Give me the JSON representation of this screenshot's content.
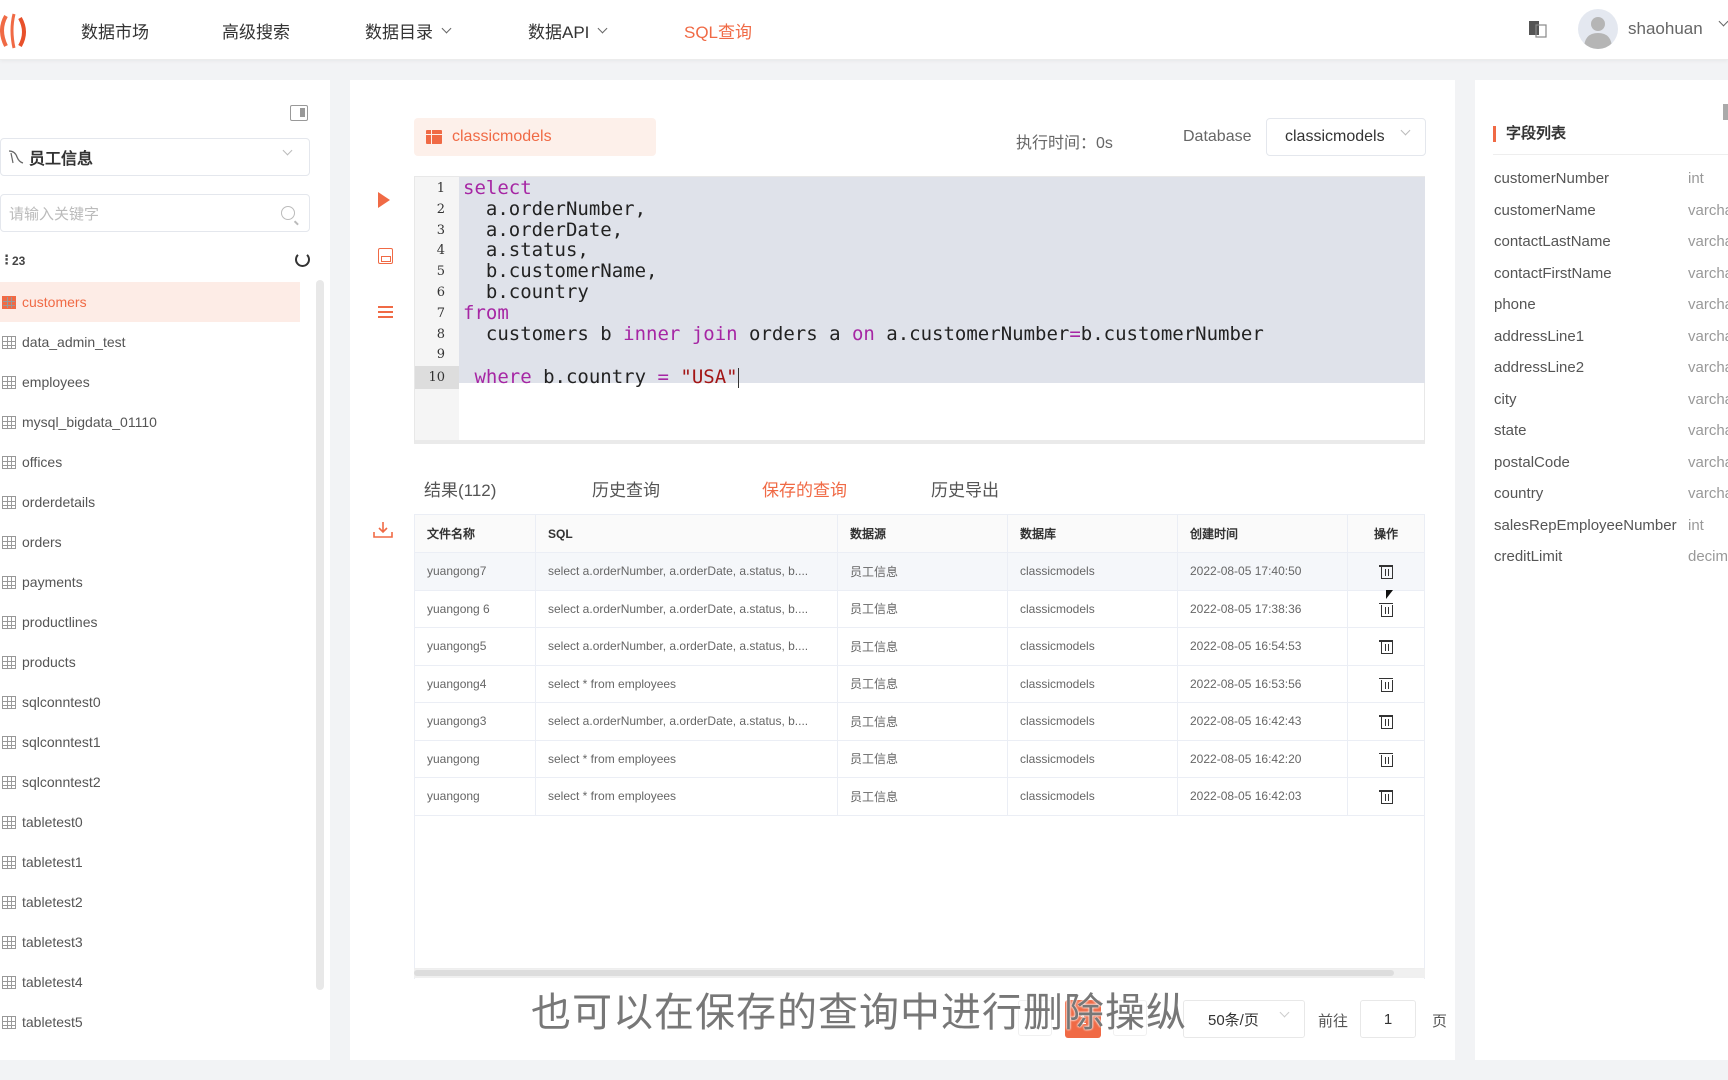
{
  "topbar": {
    "logo": "brand-logo",
    "nav": [
      {
        "label": "数据市场",
        "has_dropdown": false
      },
      {
        "label": "高级搜索",
        "has_dropdown": false
      },
      {
        "label": "数据目录",
        "has_dropdown": true
      },
      {
        "label": "数据API",
        "has_dropdown": true
      },
      {
        "label": "SQL查询",
        "has_dropdown": false,
        "active": true
      }
    ],
    "username": "shaohuan"
  },
  "left_panel": {
    "datasource": "员工信息",
    "search_placeholder": "请输入关键字",
    "table_count": "23",
    "tables": [
      {
        "name": "customers",
        "active": true
      },
      {
        "name": "data_admin_test"
      },
      {
        "name": "employees"
      },
      {
        "name": "mysql_bigdata_01110"
      },
      {
        "name": "offices"
      },
      {
        "name": "orderdetails"
      },
      {
        "name": "orders"
      },
      {
        "name": "payments"
      },
      {
        "name": "productlines"
      },
      {
        "name": "products"
      },
      {
        "name": "sqlconntest0"
      },
      {
        "name": "sqlconntest1"
      },
      {
        "name": "sqlconntest2"
      },
      {
        "name": "tabletest0"
      },
      {
        "name": "tabletest1"
      },
      {
        "name": "tabletest2"
      },
      {
        "name": "tabletest3"
      },
      {
        "name": "tabletest4"
      },
      {
        "name": "tabletest5"
      }
    ]
  },
  "editor": {
    "db_tag": "classicmodels",
    "exec_time": "执行时间：0s",
    "database_label": "Database",
    "database_value": "classicmodels",
    "lines": [
      {
        "n": "1",
        "code": "select"
      },
      {
        "n": "2",
        "code": "  a.orderNumber,"
      },
      {
        "n": "3",
        "code": "  a.orderDate,"
      },
      {
        "n": "4",
        "code": "  a.status,"
      },
      {
        "n": "5",
        "code": "  b.customerName,"
      },
      {
        "n": "6",
        "code": "  b.country"
      },
      {
        "n": "7",
        "code": "from"
      },
      {
        "n": "8",
        "code": "  customers b inner join orders a on a.customerNumber=b.customerNumber"
      },
      {
        "n": "9",
        "code": ""
      },
      {
        "n": "10",
        "code": " where b.country = \"USA\""
      }
    ]
  },
  "tabs": [
    {
      "label": "结果(112)"
    },
    {
      "label": "历史查询"
    },
    {
      "label": "保存的查询",
      "active": true
    },
    {
      "label": "历史导出"
    }
  ],
  "saved_queries": {
    "columns": [
      "文件名称",
      "SQL",
      "数据源",
      "数据库",
      "创建时间",
      "操作"
    ],
    "rows": [
      [
        "yuangong7",
        "select a.orderNumber, a.orderDate, a.status, b....",
        "员工信息",
        "classicmodels",
        "2022-08-05 17:40:50"
      ],
      [
        "yuangong 6",
        "select a.orderNumber, a.orderDate, a.status, b....",
        "员工信息",
        "classicmodels",
        "2022-08-05 17:38:36"
      ],
      [
        "yuangong5",
        "select a.orderNumber, a.orderDate, a.status, b....",
        "员工信息",
        "classicmodels",
        "2022-08-05 16:54:53"
      ],
      [
        "yuangong4",
        "select * from employees",
        "员工信息",
        "classicmodels",
        "2022-08-05 16:53:56"
      ],
      [
        "yuangong3",
        "select a.orderNumber, a.orderDate, a.status, b....",
        "员工信息",
        "classicmodels",
        "2022-08-05 16:42:43"
      ],
      [
        "yuangong",
        "select * from employees",
        "员工信息",
        "classicmodels",
        "2022-08-05 16:42:20"
      ],
      [
        "yuangong",
        "select * from employees",
        "员工信息",
        "classicmodels",
        "2022-08-05 16:42:03"
      ]
    ]
  },
  "pagination": {
    "current_page": "1",
    "page_size": "50条/页",
    "goto_label": "前往",
    "goto_value": "1",
    "page_suffix": "页"
  },
  "right_panel": {
    "title": "字段列表",
    "fields": [
      {
        "name": "customerNumber",
        "type": "int"
      },
      {
        "name": "customerName",
        "type": "varchar"
      },
      {
        "name": "contactLastName",
        "type": "varchar"
      },
      {
        "name": "contactFirstName",
        "type": "varchar"
      },
      {
        "name": "phone",
        "type": "varchar"
      },
      {
        "name": "addressLine1",
        "type": "varchar"
      },
      {
        "name": "addressLine2",
        "type": "varchar"
      },
      {
        "name": "city",
        "type": "varchar"
      },
      {
        "name": "state",
        "type": "varchar"
      },
      {
        "name": "postalCode",
        "type": "varchar"
      },
      {
        "name": "country",
        "type": "varchar"
      },
      {
        "name": "salesRepEmployeeNumber",
        "type": "int"
      },
      {
        "name": "creditLimit",
        "type": "decimal"
      }
    ]
  },
  "subtitle": "也可以在保存的查询中进行删除操纵",
  "colors": {
    "accent": "#f06a45",
    "selection": "#dfe2ea",
    "keyword": "#a626a4"
  }
}
